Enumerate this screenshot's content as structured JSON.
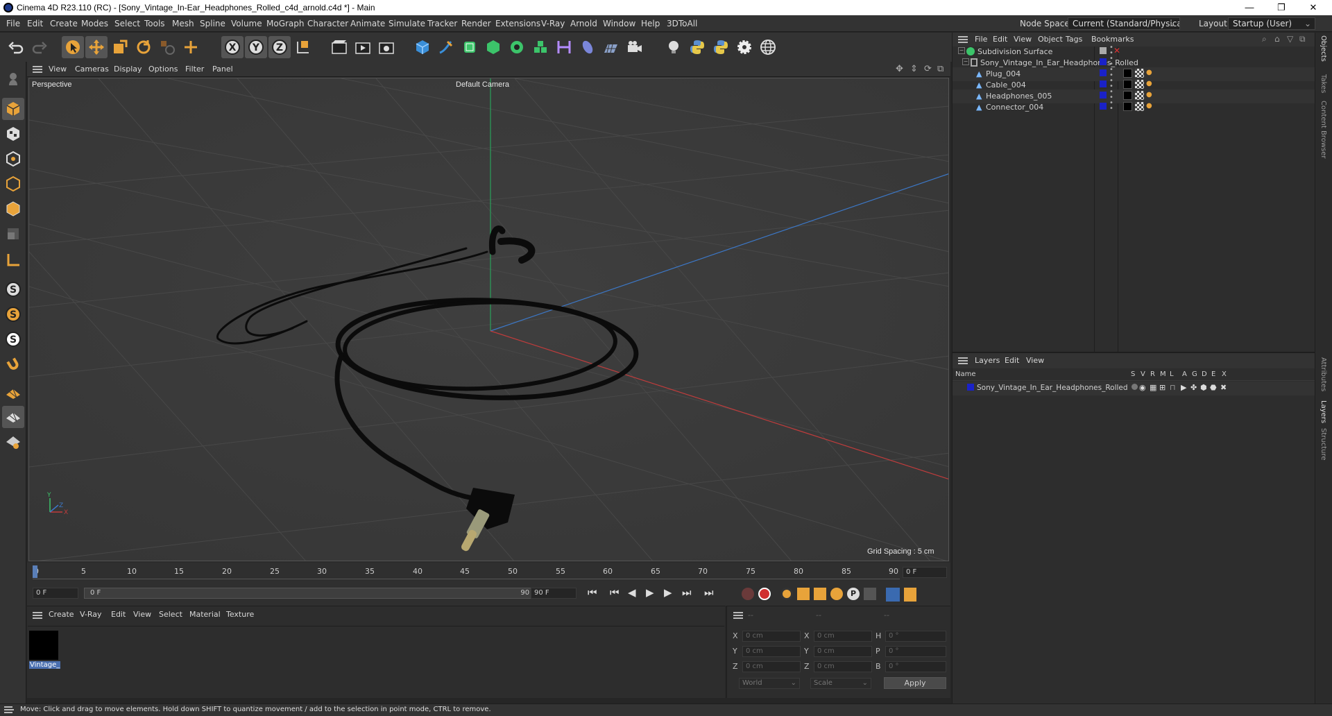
{
  "window": {
    "title": "Cinema 4D R23.110 (RC) - [Sony_Vintage_In-Ear_Headphones_Rolled_c4d_arnold.c4d *] - Main",
    "minimize": "—",
    "maximize": "❐",
    "close": "✕"
  },
  "menubar": {
    "items": [
      "File",
      "Edit",
      "Create",
      "Modes",
      "Select",
      "Tools",
      "Mesh",
      "Spline",
      "Volume",
      "MoGraph",
      "Character",
      "Animate",
      "Simulate",
      "Tracker",
      "Render",
      "Extensions",
      "V-Ray",
      "Arnold",
      "Window",
      "Help",
      "3DToAll"
    ],
    "node_space_label": "Node Space:",
    "node_space_value": "Current (Standard/Physical)",
    "layout_label": "Layout:",
    "layout_value": "Startup (User)"
  },
  "viewport": {
    "menu": [
      "View",
      "Cameras",
      "Display",
      "Options",
      "Filter",
      "Panel"
    ],
    "projection": "Perspective",
    "camera": "Default Camera",
    "grid_spacing": "Grid Spacing : 5 cm"
  },
  "timeline": {
    "ticks": [
      "0",
      "5",
      "10",
      "15",
      "20",
      "25",
      "30",
      "35",
      "40",
      "45",
      "50",
      "55",
      "60",
      "65",
      "70",
      "75",
      "80",
      "85",
      "90"
    ],
    "current_frame": "0 F",
    "start_frame": "0 F",
    "range_start": "0 F",
    "range_end": "90 F",
    "end_frame": "90 F",
    "end_frame2": "0 F"
  },
  "material_manager": {
    "menu": [
      "Create",
      "V-Ray",
      "Edit",
      "View",
      "Select",
      "Material",
      "Texture"
    ],
    "materials": [
      {
        "name": "Vintage_",
        "color": "#000000"
      }
    ]
  },
  "coordinates": {
    "header": [
      "--",
      "--",
      "--"
    ],
    "rows": [
      {
        "a": "X",
        "av": "0 cm",
        "b": "X",
        "bv": "0 cm",
        "c": "H",
        "cv": "0 °"
      },
      {
        "a": "Y",
        "av": "0 cm",
        "b": "Y",
        "bv": "0 cm",
        "c": "P",
        "cv": "0 °"
      },
      {
        "a": "Z",
        "av": "0 cm",
        "b": "Z",
        "bv": "0 cm",
        "c": "B",
        "cv": "0 °"
      }
    ],
    "mode": "World",
    "size_mode": "Scale",
    "apply": "Apply"
  },
  "object_manager": {
    "menu": [
      "File",
      "Edit",
      "View",
      "Object",
      "Tags",
      "Bookmarks"
    ],
    "objects": [
      {
        "name": "Subdivision Surface",
        "level": 0
      },
      {
        "name": "Sony_Vintage_In_Ear_Headphones_Rolled",
        "level": 1
      },
      {
        "name": "Plug_004",
        "level": 2
      },
      {
        "name": "Cable_004",
        "level": 2
      },
      {
        "name": "Headphones_005",
        "level": 2
      },
      {
        "name": "Connector_004",
        "level": 2
      }
    ],
    "layer_color": "#1a22c8"
  },
  "layers_manager": {
    "menu": [
      "Layers",
      "Edit",
      "View"
    ],
    "col_name": "Name",
    "cols": [
      "S",
      "V",
      "R",
      "M",
      "L",
      "A",
      "G",
      "D",
      "E",
      "X"
    ],
    "layers": [
      {
        "name": "Sony_Vintage_In_Ear_Headphones_Rolled",
        "color": "#1a22c8"
      }
    ]
  },
  "side_tabs": {
    "top": [
      "Objects",
      "Takes",
      "Content Browser"
    ],
    "bottom": [
      "Attributes",
      "Layers",
      "Structure"
    ]
  },
  "status": {
    "text": "Move: Click and drag to move elements. Hold down SHIFT to quantize movement / add to the selection in point mode, CTRL to remove."
  }
}
